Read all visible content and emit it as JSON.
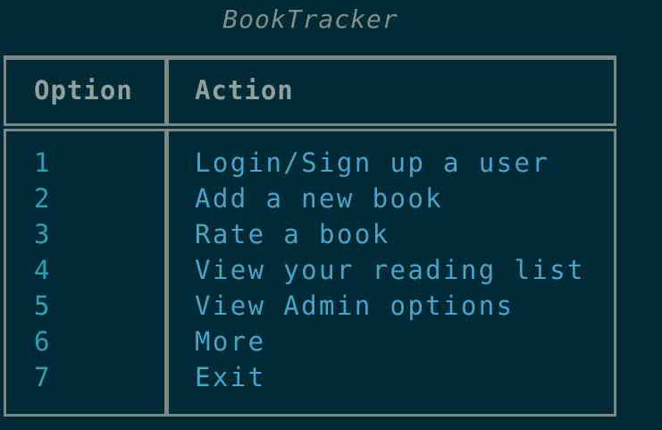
{
  "app": {
    "title": "BookTracker"
  },
  "menu": {
    "headers": {
      "option": "Option",
      "action": "Action"
    },
    "rows": [
      {
        "option": "1",
        "action": "Login/Sign up a user"
      },
      {
        "option": "2",
        "action": "Add a new book"
      },
      {
        "option": "3",
        "action": "Rate a book"
      },
      {
        "option": "4",
        "action": "View your reading list"
      },
      {
        "option": "5",
        "action": "View Admin options"
      },
      {
        "option": "6",
        "action": "More"
      },
      {
        "option": "7",
        "action": "Exit"
      }
    ]
  },
  "colors": {
    "background": "#002b36",
    "border": "#7b8a88",
    "header_text": "#8fa09e",
    "option_text": "#2aa1b3",
    "action_text": "#4aa3c8",
    "title_text": "#7f8f8c"
  }
}
